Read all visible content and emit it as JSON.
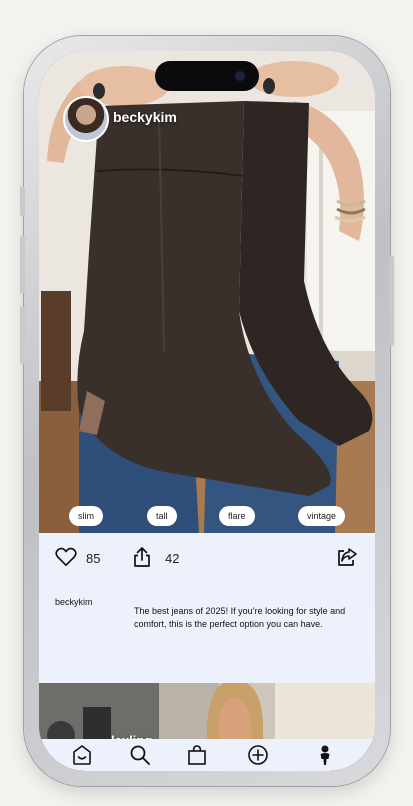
{
  "post": {
    "username": "beckykim",
    "tags": [
      "slim",
      "tall",
      "flare",
      "vintage"
    ],
    "likes": "85",
    "shares": "42",
    "author": "beckykim",
    "caption": "The best jeans of 2025! If you’re looking for style and comfort, this is the perfect option you can have."
  },
  "next_post": {
    "username": "lexling"
  },
  "nav": {
    "items": [
      "home-icon",
      "search-icon",
      "shopping-bag-icon",
      "add-icon",
      "profile-icon"
    ]
  },
  "colors": {
    "panel": "#edf1fb",
    "text": "#111111"
  }
}
